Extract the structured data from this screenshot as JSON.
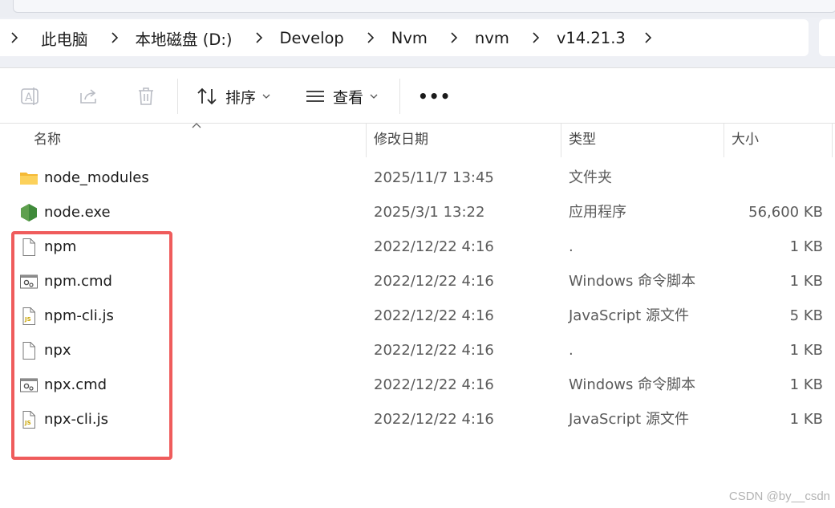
{
  "breadcrumb": {
    "items": [
      "此电脑",
      "本地磁盘 (D:)",
      "Develop",
      "Nvm",
      "nvm",
      "v14.21.3"
    ]
  },
  "toolbar": {
    "icons": [
      "rename-icon",
      "share-icon",
      "delete-icon"
    ],
    "sort_label": "排序",
    "view_label": "查看",
    "more_label": "•••"
  },
  "columns": {
    "name": "名称",
    "date": "修改日期",
    "type": "类型",
    "size": "大小"
  },
  "files": [
    {
      "name": "node_modules",
      "date": "2025/11/7 13:45",
      "type": "文件夹",
      "size": "",
      "icon": "folder-icon"
    },
    {
      "name": "node.exe",
      "date": "2025/3/1 13:22",
      "type": "应用程序",
      "size": "56,600 KB",
      "icon": "nodejs-icon"
    },
    {
      "name": "npm",
      "date": "2022/12/22 4:16",
      "type": ".",
      "size": "1 KB",
      "icon": "file-icon"
    },
    {
      "name": "npm.cmd",
      "date": "2022/12/22 4:16",
      "type": "Windows 命令脚本",
      "size": "1 KB",
      "icon": "cmd-script-icon"
    },
    {
      "name": "npm-cli.js",
      "date": "2022/12/22 4:16",
      "type": "JavaScript 源文件",
      "size": "5 KB",
      "icon": "js-file-icon"
    },
    {
      "name": "npx",
      "date": "2022/12/22 4:16",
      "type": ".",
      "size": "1 KB",
      "icon": "file-icon"
    },
    {
      "name": "npx.cmd",
      "date": "2022/12/22 4:16",
      "type": "Windows 命令脚本",
      "size": "1 KB",
      "icon": "cmd-script-icon"
    },
    {
      "name": "npx-cli.js",
      "date": "2022/12/22 4:16",
      "type": "JavaScript 源文件",
      "size": "1 KB",
      "icon": "js-file-icon"
    }
  ],
  "watermark": "CSDN @by__csdn",
  "colors": {
    "highlight": "#ef5c5c",
    "folder": "#f7c948",
    "nodejs": "#5fa04e"
  }
}
